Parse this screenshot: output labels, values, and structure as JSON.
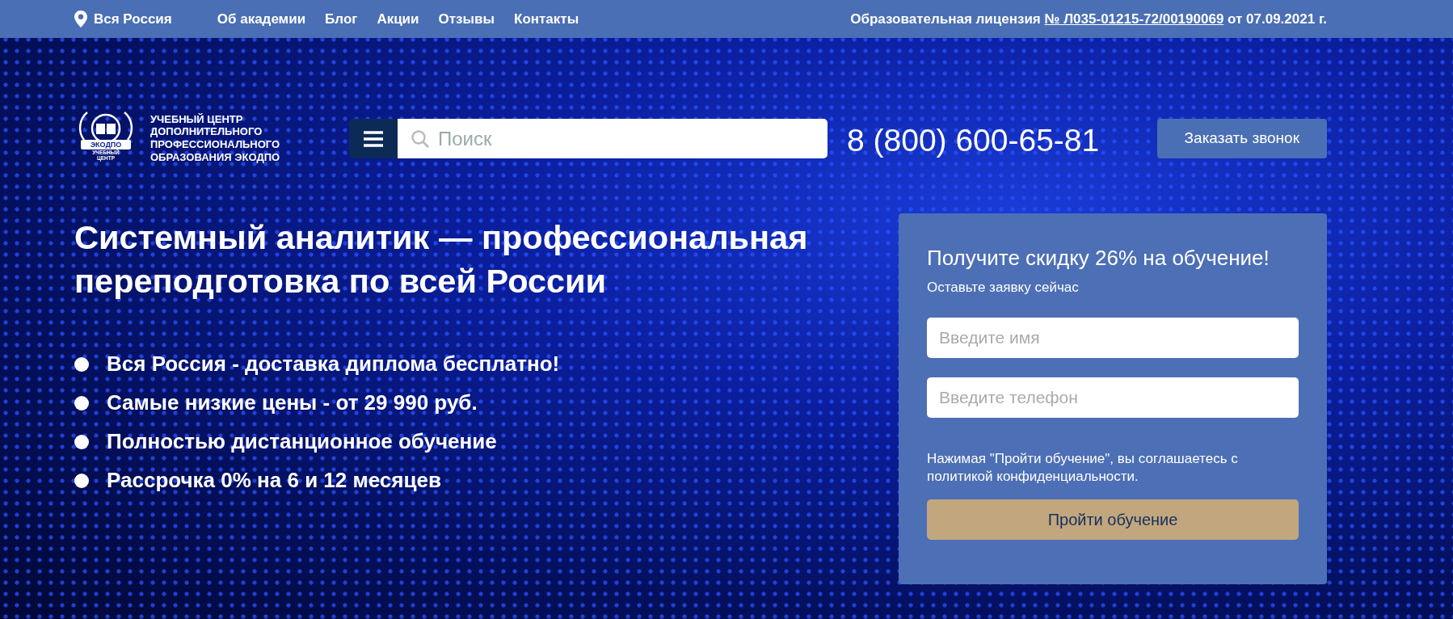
{
  "top_bar": {
    "region": "Вся Россия",
    "nav": [
      "Об академии",
      "Блог",
      "Акции",
      "Отзывы",
      "Контакты"
    ],
    "license": {
      "before": "Образовательная лицензия",
      "link": "№ Л035-01215-72/00190069",
      "after": "от 07.09.2021 г."
    }
  },
  "header": {
    "logo": {
      "ribbon": "ЭКОДПО",
      "emblem_caption": "УЧЕБНЫЙ ЦЕНТР",
      "name_lines": [
        "УЧЕБНЫЙ ЦЕНТР",
        "ДОПОЛНИТЕЛЬНОГО",
        "ПРОФЕССИОНАЛЬНОГО",
        "ОБРАЗОВАНИЯ ЭКОДПО"
      ]
    },
    "search": {
      "placeholder": "Поиск"
    },
    "phone": "8 (800) 600-65-81",
    "callback_button": "Заказать звонок"
  },
  "hero": {
    "title": "Системный аналитик — профессиональная переподготовка по всей России",
    "benefits": [
      "Вся Россия - доставка диплома бесплатно!",
      "Самые низкие цены - от 29 990 руб.",
      "Полностью дистанционное обучение",
      "Рассрочка 0% на 6 и 12 месяцев"
    ]
  },
  "form": {
    "title": "Получите скидку 26% на обучение!",
    "subtitle": "Оставьте заявку сейчас",
    "fields": [
      {
        "placeholder": "Введите имя"
      },
      {
        "placeholder": "Введите телефон"
      }
    ],
    "consent": "Нажимая \"Пройти обучение\", вы соглашаетесь с политикой конфиденциальности.",
    "submit": "Пройти обучение"
  }
}
